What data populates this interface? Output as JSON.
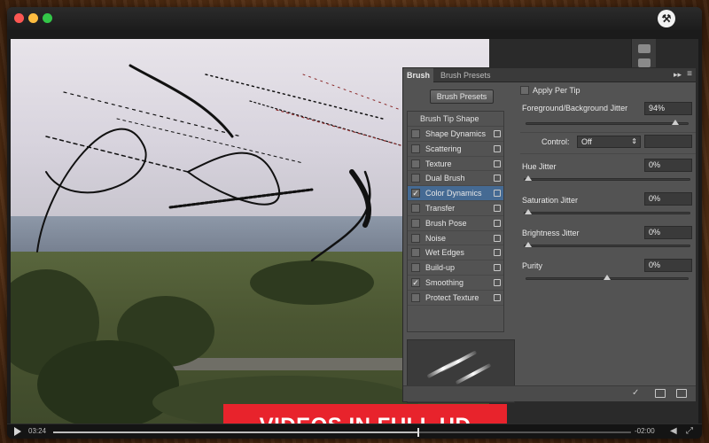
{
  "app": {
    "icons": {
      "lights": [
        "red-dot",
        "yellow-dot",
        "green-dot"
      ],
      "toolbar": "hammer-icon"
    }
  },
  "brush_panel": {
    "tabs": [
      "Brush",
      "Brush Presets"
    ],
    "presets_button": "Brush Presets",
    "list_header": "Brush Tip Shape",
    "items": [
      {
        "label": "Shape Dynamics",
        "checked": false
      },
      {
        "label": "Scattering",
        "checked": false
      },
      {
        "label": "Texture",
        "checked": false
      },
      {
        "label": "Dual Brush",
        "checked": false
      },
      {
        "label": "Color Dynamics",
        "checked": true
      },
      {
        "label": "Transfer",
        "checked": false
      },
      {
        "label": "Brush Pose",
        "checked": false
      },
      {
        "label": "Noise",
        "checked": false
      },
      {
        "label": "Wet Edges",
        "checked": false
      },
      {
        "label": "Build-up",
        "checked": false
      },
      {
        "label": "Smoothing",
        "checked": true
      },
      {
        "label": "Protect Texture",
        "checked": false
      }
    ],
    "selected_item": "Color Dynamics",
    "apply_per_tip": {
      "label": "Apply Per Tip",
      "checked": false
    },
    "fg_bg_jitter": {
      "label": "Foreground/Background Jitter",
      "value": "94%",
      "level": 0.94
    },
    "control": {
      "label": "Control:",
      "value": "Off"
    },
    "hue_jitter": {
      "label": "Hue Jitter",
      "value": "0%",
      "level": 0.0
    },
    "saturation_jitter": {
      "label": "Saturation Jitter",
      "value": "0%",
      "level": 0.0
    },
    "brightness_jitter": {
      "label": "Brightness Jitter",
      "value": "0%",
      "level": 0.0
    },
    "purity": {
      "label": "Purity",
      "value": "0%",
      "level": 0.5
    }
  },
  "banner": {
    "text": "VIDEOS IN FULL HD"
  },
  "player": {
    "elapsed": "03:24",
    "remaining": "-02:00",
    "progress": 0.63
  },
  "colors": {
    "banner": "#e8232c",
    "selection": "#456a93"
  }
}
